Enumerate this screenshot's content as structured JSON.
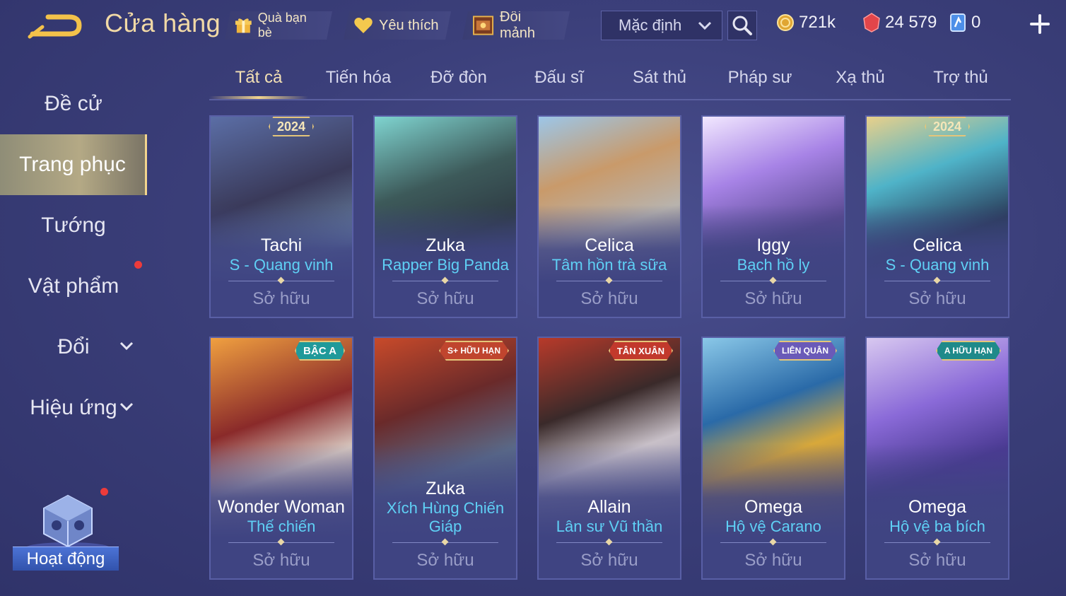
{
  "header": {
    "title": "Cửa hàng",
    "gift_label": "Quà bạn bè",
    "favorite_label": "Yêu thích",
    "exchange_label": "Đổi mảnh",
    "sort_value": "Mặc định",
    "gold": "721k",
    "gems": "24 579",
    "cards": "0"
  },
  "sidebar": {
    "items": [
      {
        "label": "Đề cử"
      },
      {
        "label": "Trang phục"
      },
      {
        "label": "Tướng"
      },
      {
        "label": "Vật phẩm"
      },
      {
        "label": "Đổi"
      },
      {
        "label": "Hiệu ứng"
      }
    ],
    "activity_label": "Hoạt động"
  },
  "tabs": [
    "Tất cả",
    "Tiến hóa",
    "Đỡ đòn",
    "Đấu sĩ",
    "Sát thủ",
    "Pháp sư",
    "Xạ thủ",
    "Trợ thủ"
  ],
  "cards": [
    {
      "hero": "Tachi",
      "skin": "S - Quang vinh",
      "status": "Sở hữu",
      "badge": "2024"
    },
    {
      "hero": "Zuka",
      "skin": "Rapper Big Panda",
      "status": "Sở hữu",
      "badge": ""
    },
    {
      "hero": "Celica",
      "skin": "Tâm hồn trà sữa",
      "status": "Sở hữu",
      "badge": ""
    },
    {
      "hero": "Iggy",
      "skin": "Bạch hồ ly",
      "status": "Sở hữu",
      "badge": ""
    },
    {
      "hero": "Celica",
      "skin": "S - Quang vinh",
      "status": "Sở hữu",
      "badge": "2024"
    },
    {
      "hero": "Wonder Woman",
      "skin": "Thế chiến",
      "status": "Sở hữu",
      "badge": "BẬC A"
    },
    {
      "hero": "Zuka",
      "skin": "Xích Hùng Chiến Giáp",
      "status": "Sở hữu",
      "badge": "S+ HỮU HẠN"
    },
    {
      "hero": "Allain",
      "skin": "Lân sư Vũ thần",
      "status": "Sở hữu",
      "badge": "TÂN XUÂN"
    },
    {
      "hero": "Omega",
      "skin": "Hộ vệ Carano",
      "status": "Sở hữu",
      "badge": "LIÊN QUÂN"
    },
    {
      "hero": "Omega",
      "skin": "Hộ vệ ba bích",
      "status": "Sở hữu",
      "badge": "A HỮU HẠN"
    }
  ],
  "colors": {
    "accent_gold": "#f1d48e",
    "skin_name": "#5fd0f5",
    "notification": "#ec3b3b"
  }
}
